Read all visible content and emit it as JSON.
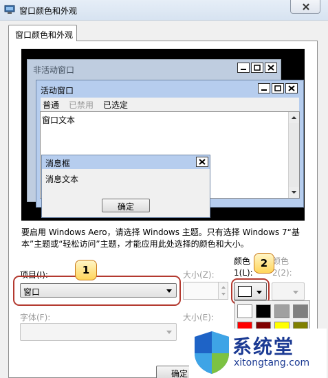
{
  "window": {
    "title": "窗口颜色和外观"
  },
  "tabs": [
    {
      "label": "窗口颜色和外观"
    }
  ],
  "preview": {
    "inactive_window_title": "非活动窗口",
    "active_window_title": "活动窗口",
    "menu": {
      "normal": "普通",
      "disabled": "已禁用",
      "selected": "已选定"
    },
    "window_text": "窗口文本",
    "message_box": {
      "title": "消息框",
      "text": "消息文本",
      "ok_label": "确定"
    }
  },
  "description": "要启用 Windows Aero，请选择 Windows 主题。只有选择 Windows 7“基本”主题或“轻松访问”主题，才能应用此处选择的颜色和大小。",
  "controls": {
    "item_label": "项目(I):",
    "item_value": "窗口",
    "size_label": "大小(Z):",
    "color1_label": "颜色 1(L):",
    "color2_label": "颜色 2(2):",
    "font_label": "字体(F):",
    "font_size_label": "大小(E):"
  },
  "callouts": {
    "one": "1",
    "two": "2"
  },
  "buttons": {
    "confirm": "确定"
  },
  "watermark": {
    "text": "系统堂",
    "url": "xitongtang.com"
  },
  "colors": {
    "palette": [
      "#ffffff",
      "#000000",
      "#a0a0a0",
      "#808080",
      "#ff0000",
      "#800000",
      "#ffff00",
      "#808000"
    ]
  }
}
